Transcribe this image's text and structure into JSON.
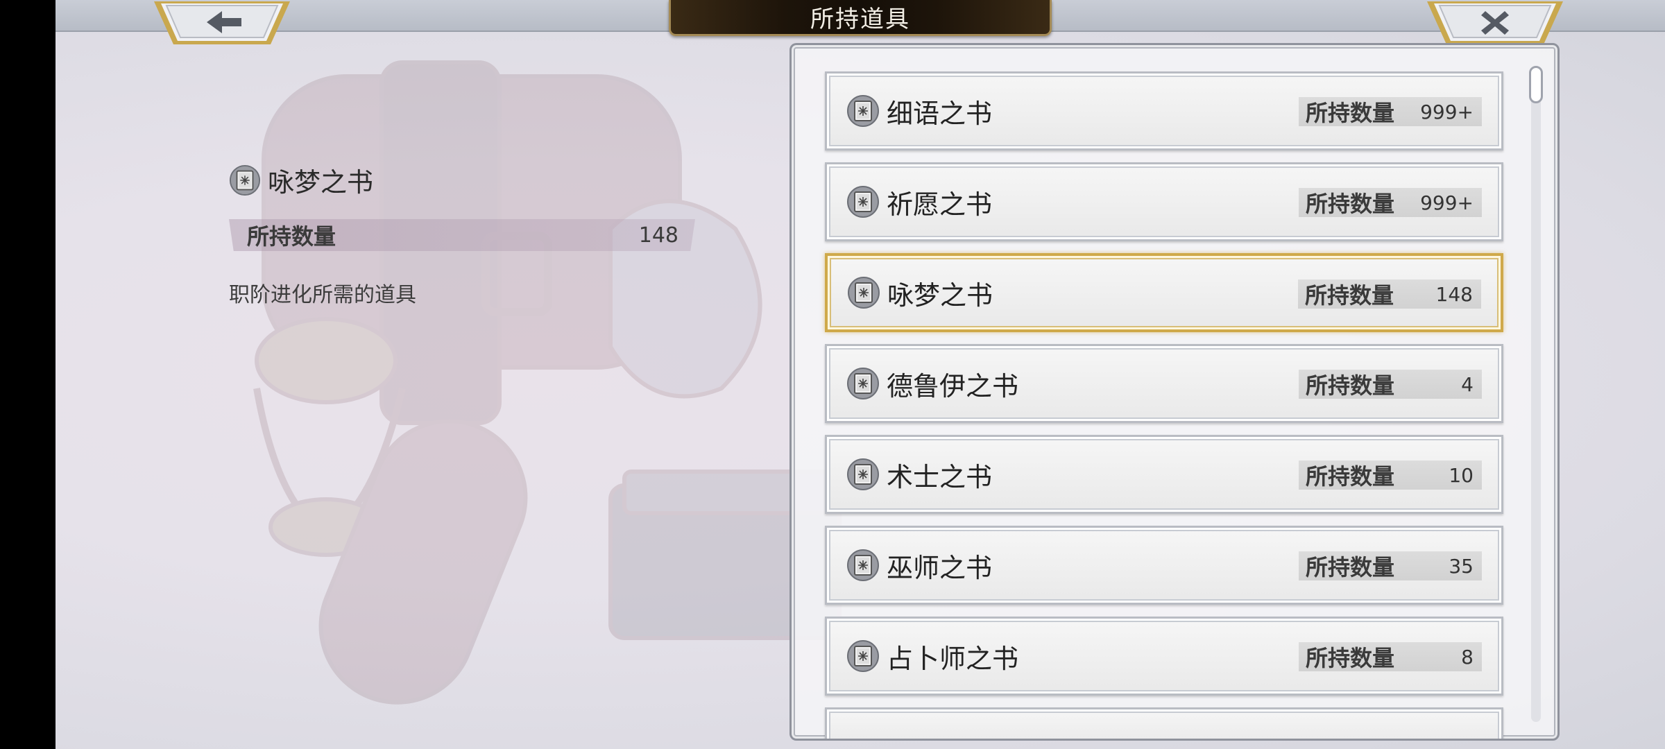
{
  "header": {
    "title": "所持道具"
  },
  "icons": {
    "back": "arrow-left-icon",
    "close": "close-x-icon",
    "item": "book-icon"
  },
  "detail": {
    "name": "咏梦之书",
    "owned_label": "所持数量",
    "owned_value": "148",
    "description": "职阶进化所需的道具"
  },
  "list": {
    "items": [
      {
        "name": "细语之书",
        "count_label": "所持数量",
        "count": "999+"
      },
      {
        "name": "祈愿之书",
        "count_label": "所持数量",
        "count": "999+"
      },
      {
        "name": "咏梦之书",
        "count_label": "所持数量",
        "count": "148",
        "selected": true
      },
      {
        "name": "德鲁伊之书",
        "count_label": "所持数量",
        "count": "4"
      },
      {
        "name": "术士之书",
        "count_label": "所持数量",
        "count": "10"
      },
      {
        "name": "巫师之书",
        "count_label": "所持数量",
        "count": "35"
      },
      {
        "name": "占卜师之书",
        "count_label": "所持数量",
        "count": "8"
      }
    ]
  },
  "colors": {
    "selected_border": "#cfa94a",
    "title_plate": "#1d140a"
  }
}
